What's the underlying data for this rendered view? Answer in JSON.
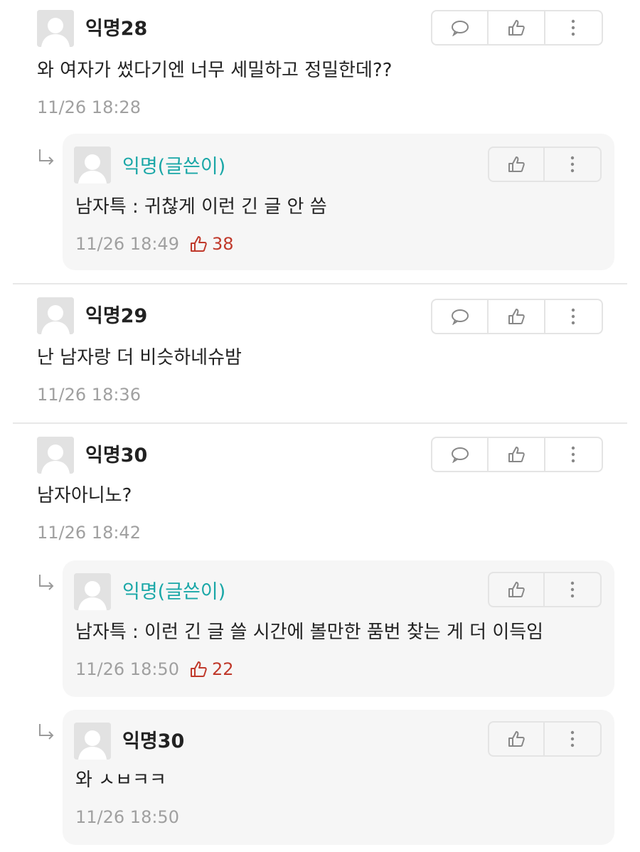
{
  "colors": {
    "author_nick": "#1aa7a7",
    "like_count": "#c0392b",
    "timestamp": "#a0a0a0",
    "reply_bg": "#f6f6f6"
  },
  "comments": [
    {
      "nick": "익명28",
      "content": "와 여자가 썼다기엔 너무 세밀하고 정밀한데??",
      "time": "11/26 18:28",
      "replies": [
        {
          "nick": "익명(글쓴이)",
          "is_author": true,
          "content": "남자특 : 귀찮게 이런 긴 글 안 씀",
          "time": "11/26 18:49",
          "likes": "38"
        }
      ]
    },
    {
      "nick": "익명29",
      "content": "난 남자랑 더 비슷하네슈밤",
      "time": "11/26 18:36",
      "replies": []
    },
    {
      "nick": "익명30",
      "content": "남자아니노?",
      "time": "11/26 18:42",
      "replies": [
        {
          "nick": "익명(글쓴이)",
          "is_author": true,
          "content": "남자특 : 이런 긴 글 쓸 시간에 볼만한 품번 찾는 게 더 이득임",
          "time": "11/26 18:50",
          "likes": "22"
        },
        {
          "nick": "익명30",
          "is_author": false,
          "content": "와 ㅅㅂㅋㅋ",
          "time": "11/26 18:50"
        }
      ]
    }
  ],
  "icons": {
    "reply": "speech-bubble-icon",
    "like": "thumbs-up-icon",
    "more": "vertical-dots-icon",
    "avatar": "default-avatar-icon",
    "reply_arrow": "reply-arrow-icon"
  }
}
